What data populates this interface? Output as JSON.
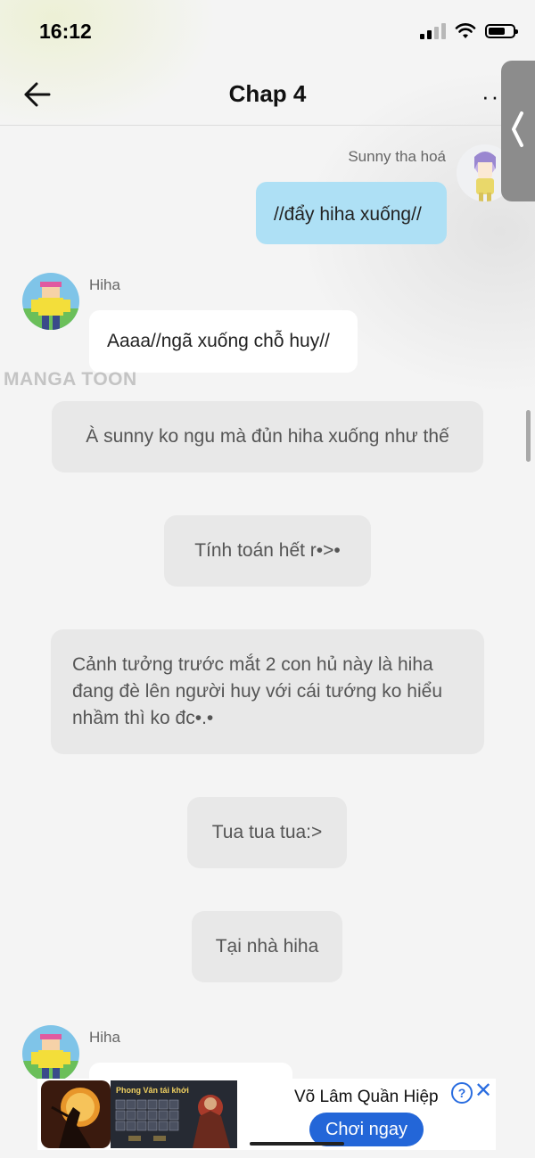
{
  "status_bar": {
    "time": "16:12",
    "battery_level": 0.7
  },
  "nav": {
    "title": "Chap 4",
    "more_label": "··"
  },
  "watermark": "MANGA TOON",
  "messages": [
    {
      "speaker": "Sunny tha hoá",
      "text": "//đẩy hiha xuống//"
    },
    {
      "speaker": "Hiha",
      "text": "Aaaa//ngã xuống chỗ huy//"
    }
  ],
  "narrations": [
    "À sunny ko ngu mà đủn hiha xuống như thế",
    "Tính toán hết r•>•",
    "Cảnh tưởng trước mắt 2 con hủ này là hiha đang đè lên người huy với cái tướng ko hiểu nhầm thì ko đc•.•",
    "Tua tua tua:>",
    "Tại nhà hiha"
  ],
  "last_speaker": "Hiha",
  "ad": {
    "screenshot_title": "Phong Vân tái khởi",
    "title": "Võ Lâm Quần Hiệp",
    "info_label": "?",
    "close_label": "✕",
    "cta": "Chơi ngay"
  },
  "colors": {
    "bubble_right": "#aee0f5",
    "bubble_left": "#ffffff",
    "narration": "#e8e8e8",
    "cta": "#2366d8",
    "side_tab": "#8c8c8c"
  }
}
